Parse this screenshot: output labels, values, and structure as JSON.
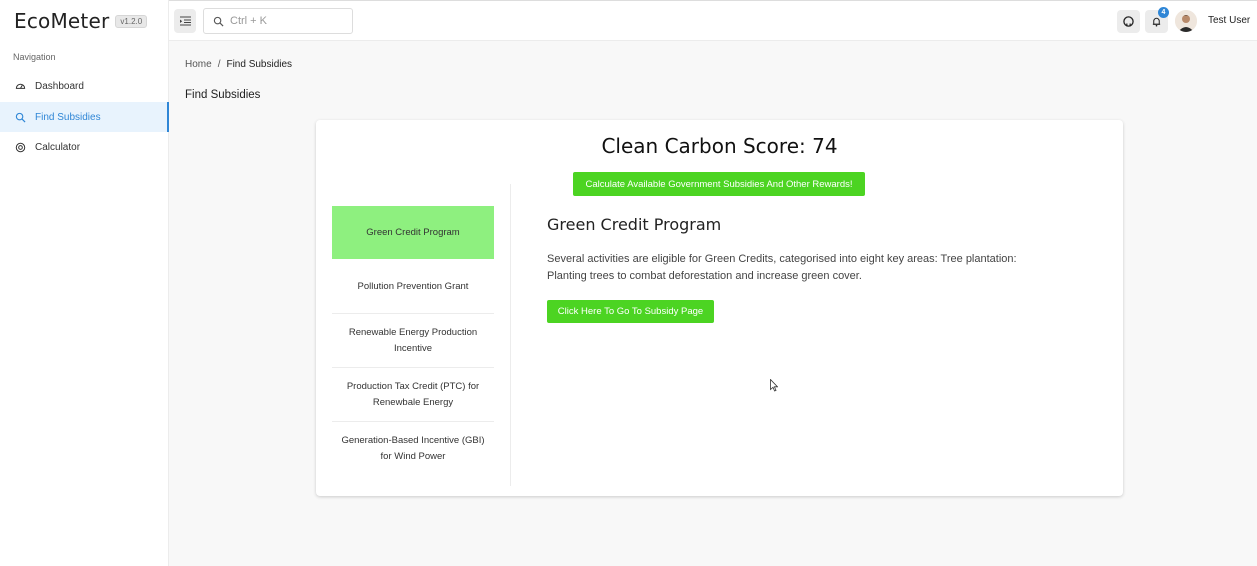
{
  "app": {
    "name": "EcoMeter",
    "version": "v1.2.0"
  },
  "sidebar": {
    "heading": "Navigation",
    "items": [
      {
        "label": "Dashboard",
        "icon": "dashboard-icon",
        "active": false
      },
      {
        "label": "Find Subsidies",
        "icon": "search-icon",
        "active": true
      },
      {
        "label": "Calculator",
        "icon": "calculator-icon",
        "active": false
      }
    ]
  },
  "topbar": {
    "search_placeholder": "Ctrl + K",
    "notification_count": "4",
    "user_name": "Test User"
  },
  "breadcrumb": {
    "home": "Home",
    "separator": "/",
    "current": "Find Subsidies"
  },
  "page_title": "Find Subsidies",
  "card": {
    "score_text": "Clean Carbon Score: 74",
    "calc_button": "Calculate Available Government Subsidies And Other Rewards!",
    "programs": [
      {
        "label": "Green Credit Program",
        "active": true
      },
      {
        "label": "Pollution Prevention Grant",
        "active": false
      },
      {
        "label": "Renewable Energy Production Incentive",
        "active": false
      },
      {
        "label": "Production Tax Credit (PTC) for Renewbale Energy",
        "active": false
      },
      {
        "label": "Generation-Based Incentive (GBI) for Wind Power",
        "active": false
      }
    ],
    "detail": {
      "title": "Green Credit Program",
      "description": "Several activities are eligible for Green Credits, categorised into eight key areas: Tree plantation: Planting trees to combat deforestation and increase green cover.",
      "button": "Click Here To Go To Subsidy Page"
    }
  },
  "colors": {
    "accent_green": "#4cd422",
    "active_program": "#8ef07f",
    "brand_blue": "#2f86d6"
  }
}
